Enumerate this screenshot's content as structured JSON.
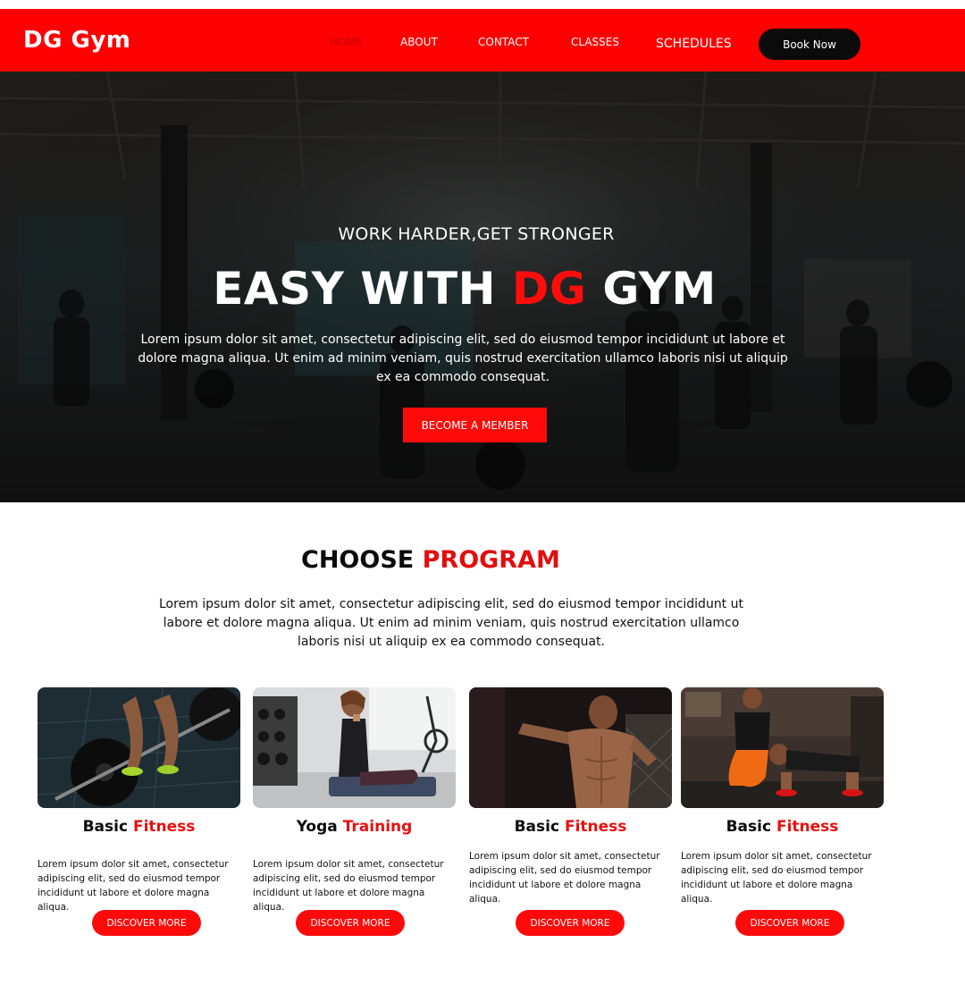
{
  "brand": {
    "logo": "DG Gym"
  },
  "nav": {
    "items": [
      {
        "label": "HOME"
      },
      {
        "label": "ABOUT"
      },
      {
        "label": "CONTACT"
      },
      {
        "label": "CLASSES"
      },
      {
        "label": "SCHEDULES"
      }
    ],
    "cta": "Book Now"
  },
  "hero": {
    "tagline": "WORK HARDER,GET STRONGER",
    "title_part1": "EASY WITH ",
    "title_highlight": "DG",
    "title_part2": " GYM",
    "description": "Lorem ipsum dolor sit amet, consectetur adipiscing elit, sed do eiusmod tempor incididunt ut labore et dolore magna aliqua. Ut enim ad minim veniam, quis nostrud exercitation ullamco laboris nisi ut aliquip ex ea commodo consequat.",
    "button": "BECOME A MEMBER"
  },
  "programs": {
    "title_part1": "CHOOSE ",
    "title_highlight": "PROGRAM",
    "description": "Lorem ipsum dolor sit amet, consectetur adipiscing elit, sed do eiusmod tempor incididunt ut labore et dolore magna aliqua. Ut enim ad minim veniam, quis nostrud exercitation ullamco laboris nisi ut aliquip ex ea commodo consequat.",
    "cards": [
      {
        "title_part1": "Basic ",
        "title_highlight": "Fitness",
        "description": "Lorem ipsum dolor sit amet, consectetur adipiscing elit, sed do eiusmod tempor incididunt ut labore et dolore magna aliqua.",
        "button": "DISCOVER MORE"
      },
      {
        "title_part1": "Yoga ",
        "title_highlight": "Training",
        "description": "Lorem ipsum dolor sit amet, consectetur adipiscing elit, sed do eiusmod tempor incididunt ut labore et dolore magna aliqua.",
        "button": "DISCOVER MORE"
      },
      {
        "title_part1": "Basic ",
        "title_highlight": "Fitness",
        "description": "Lorem ipsum dolor sit amet, consectetur adipiscing elit, sed do eiusmod tempor incididunt ut labore et dolore magna aliqua.",
        "button": "DISCOVER MORE"
      },
      {
        "title_part1": "Basic ",
        "title_highlight": "Fitness",
        "description": "Lorem ipsum dolor sit amet, consectetur adipiscing elit, sed do eiusmod tempor incididunt ut labore et dolore magna aliqua.",
        "button": "DISCOVER MORE"
      }
    ]
  },
  "colors": {
    "accent": "#ff0000",
    "dark": "#0b0b0b",
    "hero_overlay": "#1b1b1b"
  }
}
